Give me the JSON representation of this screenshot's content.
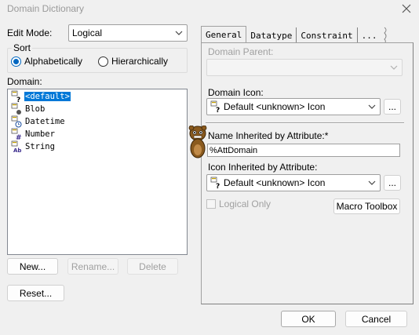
{
  "window": {
    "title": "Domain Dictionary"
  },
  "edit_mode": {
    "label": "Edit Mode:",
    "value": "Logical"
  },
  "sort": {
    "label": "Sort",
    "options": [
      {
        "label": "Alphabetically",
        "selected": true
      },
      {
        "label": "Hierarchically",
        "selected": false
      }
    ]
  },
  "domain": {
    "label": "Domain:",
    "items": [
      {
        "label": "<default>",
        "icon": "default-domain-icon",
        "selected": true
      },
      {
        "label": "Blob",
        "icon": "blob-domain-icon",
        "selected": false
      },
      {
        "label": "Datetime",
        "icon": "datetime-domain-icon",
        "selected": false
      },
      {
        "label": "Number",
        "icon": "number-domain-icon",
        "selected": false
      },
      {
        "label": "String",
        "icon": "string-domain-icon",
        "selected": false
      }
    ]
  },
  "left_buttons": {
    "new": "New...",
    "rename": "Rename...",
    "delete": "Delete",
    "reset": "Reset..."
  },
  "tabs": [
    "General",
    "Datatype",
    "Constraint",
    "..."
  ],
  "general": {
    "domain_parent_label": "Domain Parent:",
    "domain_parent_value": "",
    "domain_icon_label": "Domain Icon:",
    "domain_icon_value": "Default <unknown> Icon",
    "browse_label": "...",
    "name_inherited_label": "Name Inherited by Attribute:*",
    "name_inherited_value": "%AttDomain",
    "icon_inherited_label": "Icon Inherited by Attribute:",
    "icon_inherited_value": "Default <unknown> Icon",
    "logical_only_label": "Logical Only",
    "macro_toolbox_label": "Macro Toolbox"
  },
  "footer": {
    "ok": "OK",
    "cancel": "Cancel"
  },
  "colors": {
    "selection": "#0078d7",
    "radio_accent": "#0067c0",
    "dialog_bg": "#f0f0f0"
  }
}
